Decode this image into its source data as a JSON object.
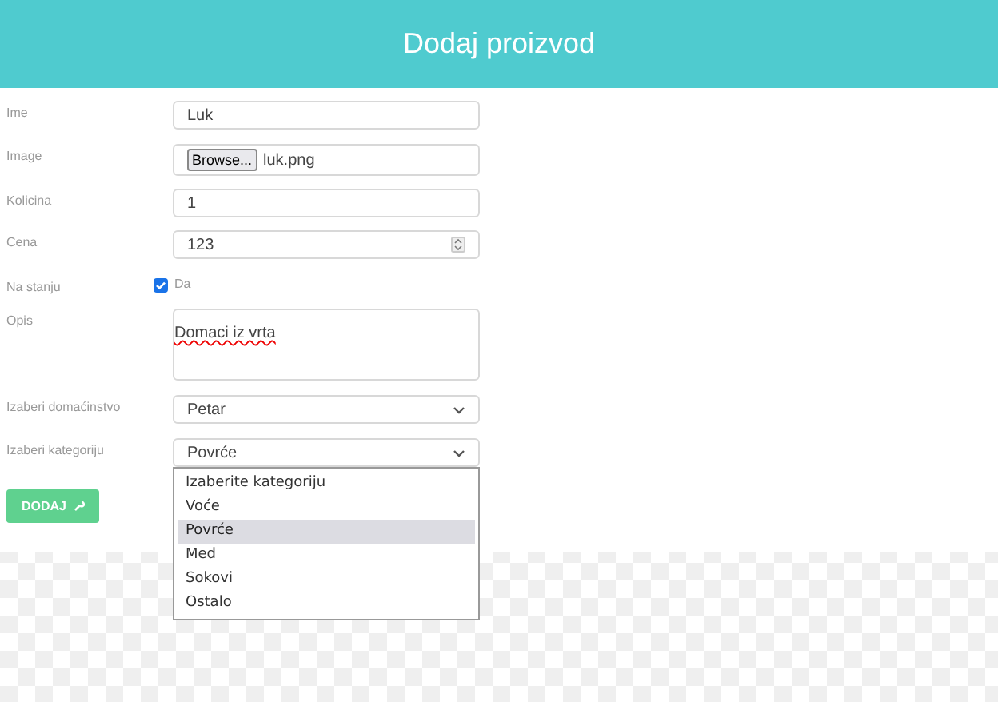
{
  "header": {
    "title": "Dodaj proizvod"
  },
  "fields": [
    {
      "kind": "text",
      "label": "Ime",
      "value": "Luk"
    },
    {
      "kind": "file",
      "label": "Image",
      "button": "Browse...",
      "value": "luk.png"
    },
    {
      "kind": "text",
      "label": "Kolicina",
      "value": "1"
    },
    {
      "kind": "number",
      "label": "Cena",
      "value": "123"
    },
    {
      "kind": "checkbox",
      "label": "Na stanju",
      "checked": true,
      "text": "Da"
    },
    {
      "kind": "textarea",
      "label": "Opis",
      "value": "Domaci iz vrta"
    },
    {
      "kind": "select",
      "label": "Izaberi domaćinstvo",
      "value": "Petar"
    },
    {
      "kind": "select",
      "label": "Izaberi kategoriju",
      "value": "Povrće",
      "open": true
    }
  ],
  "dropdown": [
    {
      "label": "Izaberite kategoriju",
      "selected": false
    },
    {
      "label": "Voće",
      "selected": false
    },
    {
      "label": "Povrće",
      "selected": true
    },
    {
      "label": "Med",
      "selected": false
    },
    {
      "label": "Sokovi",
      "selected": false
    },
    {
      "label": "Ostalo",
      "selected": false
    }
  ],
  "submit": {
    "label": "DODAJ"
  }
}
